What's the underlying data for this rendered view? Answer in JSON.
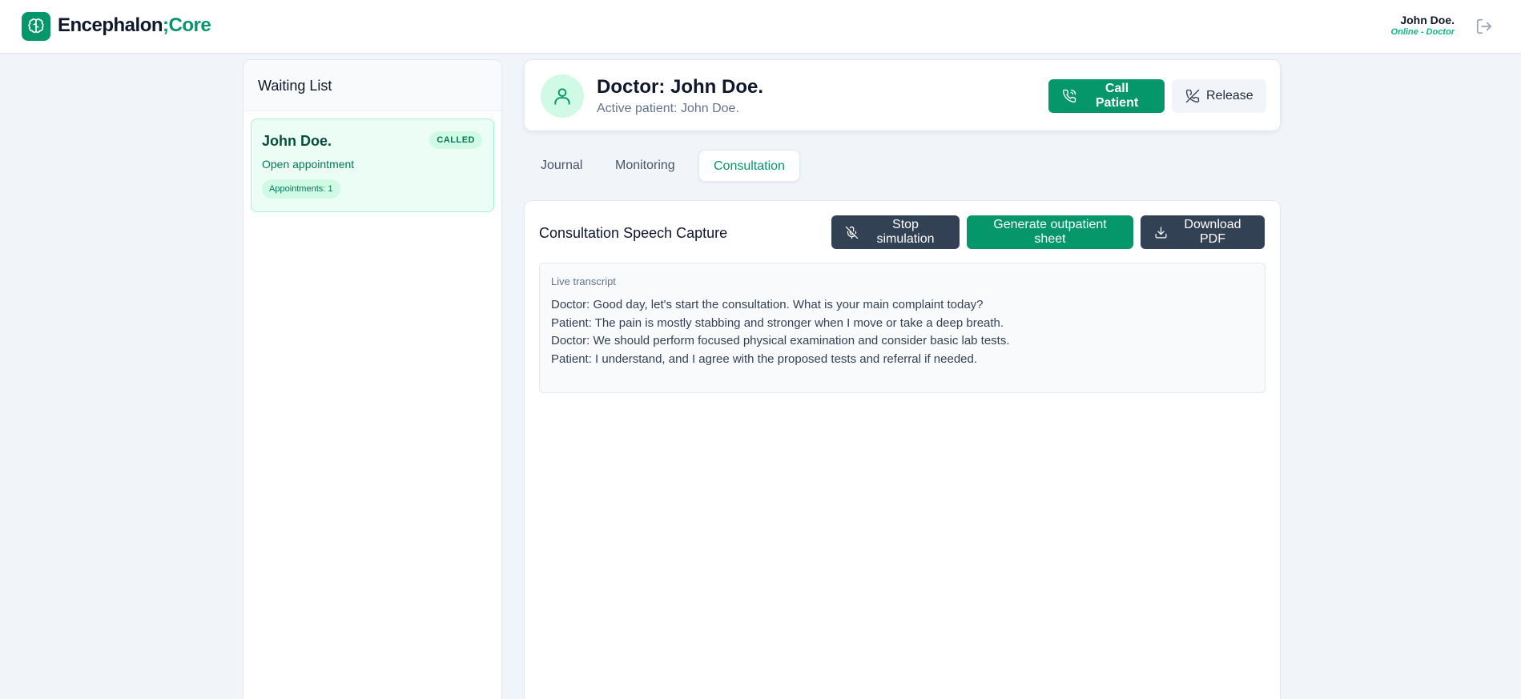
{
  "app": {
    "brand_main": "Encephalon",
    "brand_sep": ";",
    "brand_accent": "Core",
    "logo_icon": "brain-icon"
  },
  "user": {
    "name": "John Doe.",
    "status": "Online - Doctor"
  },
  "waiting_list": {
    "title": "Waiting List",
    "patients": [
      {
        "name": "John Doe.",
        "badge": "CALLED",
        "subtitle": "Open appointment",
        "count_label": "Appointments: 1"
      }
    ]
  },
  "doctor_card": {
    "title": "Doctor: John Doe.",
    "subtitle": "Active patient: John Doe.",
    "call_label": "Call Patient",
    "release_label": "Release"
  },
  "tabs": [
    {
      "label": "Journal"
    },
    {
      "label": "Monitoring"
    },
    {
      "label": "Consultation",
      "active": true
    }
  ],
  "consultation": {
    "title": "Consultation Speech Capture",
    "stop_label": "Stop simulation",
    "generate_label": "Generate outpatient sheet",
    "download_label": "Download PDF",
    "transcript_label": "Live transcript",
    "transcript": [
      "Doctor: Good day, let's start the consultation. What is your main complaint today?",
      "Patient: The pain is mostly stabbing and stronger when I move or take a deep breath.",
      "Doctor: We should perform focused physical examination and consider basic lab tests.",
      "Patient: I understand, and I agree with the proposed tests and referral if needed."
    ]
  },
  "colors": {
    "accent": "#059669",
    "accent_light": "#d1fae5",
    "dark_button": "#334155",
    "background": "#f1f5f9"
  }
}
